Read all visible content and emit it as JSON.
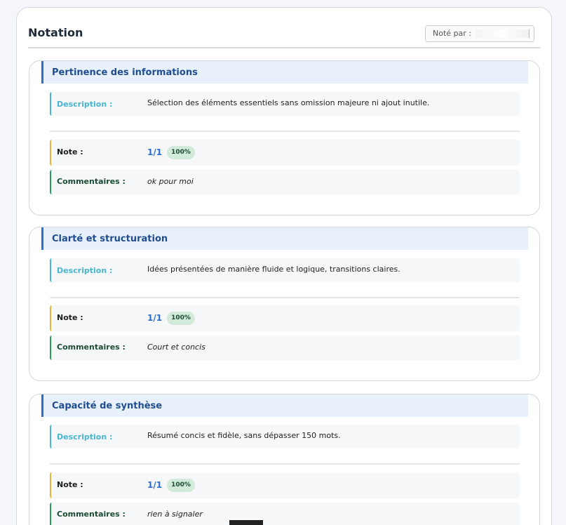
{
  "header": {
    "title": "Notation",
    "grader_label": "Noté par :"
  },
  "criteria": [
    {
      "title": "Pertinence des informations",
      "description_label": "Description :",
      "description": "Sélection des éléments essentiels sans omission majeure ni ajout inutile.",
      "note_label": "Note :",
      "score": "1/1",
      "percent": "100%",
      "comment_label": "Commentaires :",
      "comment": "ok pour moi"
    },
    {
      "title": "Clarté et structuration",
      "description_label": "Description :",
      "description": "Idées présentées de manière fluide et logique, transitions claires.",
      "note_label": "Note :",
      "score": "1/1",
      "percent": "100%",
      "comment_label": "Commentaires :",
      "comment": "Court et concis"
    },
    {
      "title": "Capacité de synthèse",
      "description_label": "Description :",
      "description": "Résumé concis et fidèle, sans dépasser 150 mots.",
      "note_label": "Note :",
      "score": "1/1",
      "percent": "100%",
      "comment_label": "Commentaires :",
      "comment": "rien à signaler"
    }
  ],
  "colors": {
    "accent": "#2d6fd1",
    "description": "#47b6cf",
    "note": "#e5b630",
    "comment": "#2f9a5e",
    "badge_bg": "#d1ead9"
  }
}
